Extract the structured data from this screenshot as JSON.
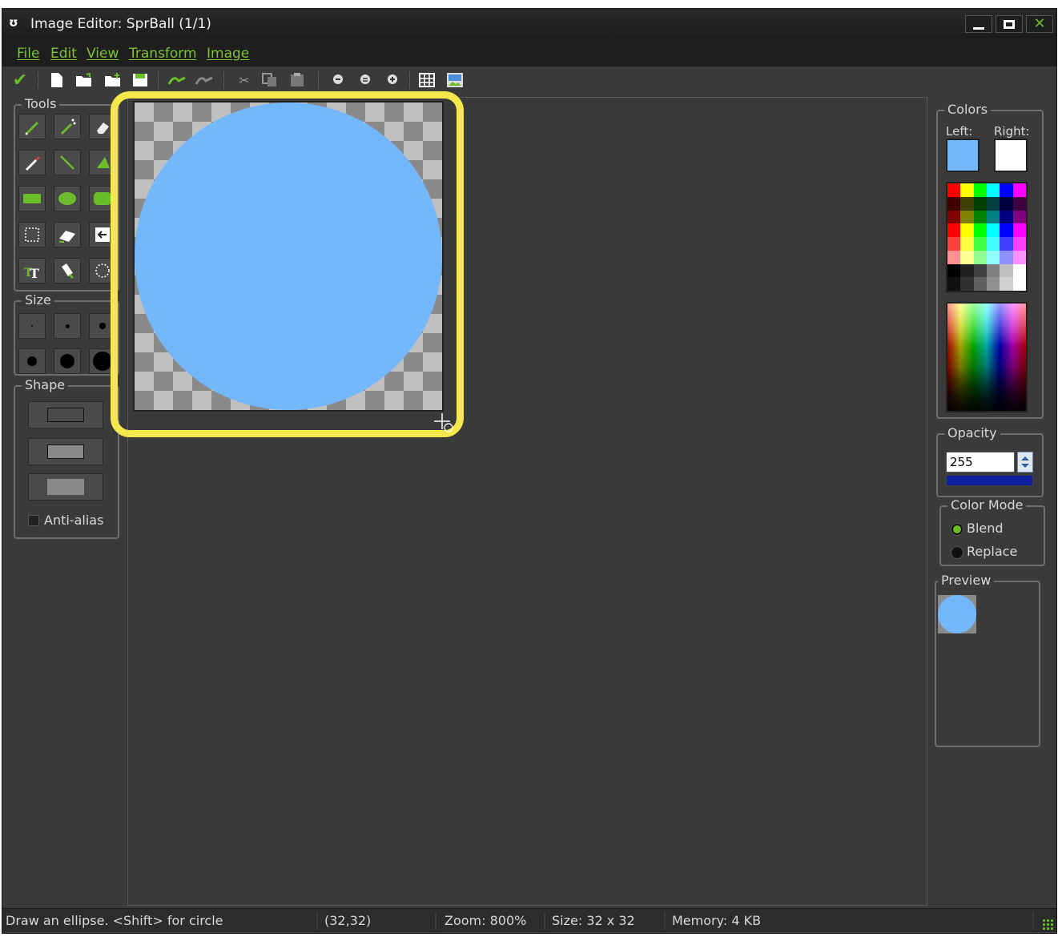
{
  "window": {
    "title": "Image Editor: SprBall (1/1)",
    "controls": {
      "minimize": "minimize",
      "maximize": "maximize",
      "close": "close"
    }
  },
  "menu": {
    "items": [
      "File",
      "Edit",
      "View",
      "Transform",
      "Image"
    ]
  },
  "toolbar": {
    "icons": [
      "confirm-check-icon",
      "new-file-icon",
      "open-file-icon",
      "import-icon",
      "save-icon",
      "undo-icon",
      "redo-icon",
      "cut-icon",
      "copy-icon",
      "paste-icon",
      "zoom-out-icon",
      "zoom-reset-icon",
      "zoom-in-icon",
      "grid-icon",
      "image-properties-icon"
    ]
  },
  "tools": {
    "label": "Tools",
    "items": [
      "pencil-icon",
      "spray-icon",
      "eraser-icon",
      "color-picker-icon",
      "line-icon",
      "polygon-icon",
      "rectangle-icon",
      "ellipse-icon",
      "rounded-rect-icon",
      "select-rect-icon",
      "magic-wand-icon",
      "select-import-icon",
      "text-icon",
      "fill-icon",
      "select-ellipse-icon"
    ]
  },
  "size": {
    "label": "Size"
  },
  "shape": {
    "label": "Shape",
    "antialias_label": "Anti-alias",
    "antialias_checked": false
  },
  "colors": {
    "label": "Colors",
    "left_label": "Left:",
    "right_label": "Right:",
    "left_color": "#74b8fb",
    "right_color": "#ffffff",
    "palette": [
      "#ff0000",
      "#ffff00",
      "#00ff00",
      "#00ffff",
      "#0000ff",
      "#ff00ff",
      "#400000",
      "#404000",
      "#004000",
      "#004040",
      "#000040",
      "#400040",
      "#800000",
      "#808000",
      "#008000",
      "#008080",
      "#000080",
      "#800080",
      "#ff0000",
      "#ffff00",
      "#00ff00",
      "#00ffff",
      "#0000ff",
      "#ff00ff",
      "#ff4040",
      "#ffff40",
      "#40ff40",
      "#40ffff",
      "#4040ff",
      "#ff40ff",
      "#ff9090",
      "#ffff90",
      "#90ff90",
      "#90ffff",
      "#9090ff",
      "#ff90ff",
      "#000000",
      "#202020",
      "#404040",
      "#808080",
      "#c0c0c0",
      "#ffffff",
      "#101010",
      "#303030",
      "#606060",
      "#909090",
      "#d0d0d0",
      "#ffffff"
    ]
  },
  "opacity": {
    "label": "Opacity",
    "value": "255",
    "bar_color": "#0a1e9e"
  },
  "color_mode": {
    "label": "Color Mode",
    "options": [
      "Blend",
      "Replace"
    ],
    "selected": "Blend"
  },
  "preview": {
    "label": "Preview"
  },
  "sprite": {
    "fill_color": "#74b8fb"
  },
  "status": {
    "hint": "Draw an ellipse. <Shift> for circle",
    "coords": "(32,32)",
    "zoom": "Zoom: 800%",
    "size": "Size: 32 x 32",
    "memory": "Memory: 4 KB"
  }
}
